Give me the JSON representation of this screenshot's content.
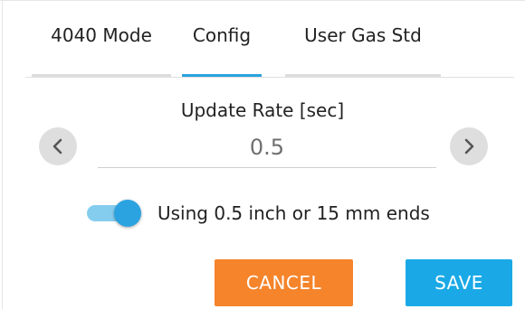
{
  "tabs": {
    "mode_4040": "4040 Mode",
    "config": "Config",
    "user_gas_std": "User Gas Std"
  },
  "update_rate": {
    "label": "Update Rate [sec]",
    "value": "0.5"
  },
  "ends_toggle": {
    "label": "Using 0.5 inch or 15 mm ends",
    "on": true
  },
  "actions": {
    "cancel": "CANCEL",
    "save": "SAVE"
  },
  "colors": {
    "accent": "#2ba3e0",
    "cancel": "#f5842b",
    "save": "#1aa9e6"
  },
  "icons": {
    "prev": "chevron-left-icon",
    "next": "chevron-right-icon"
  }
}
